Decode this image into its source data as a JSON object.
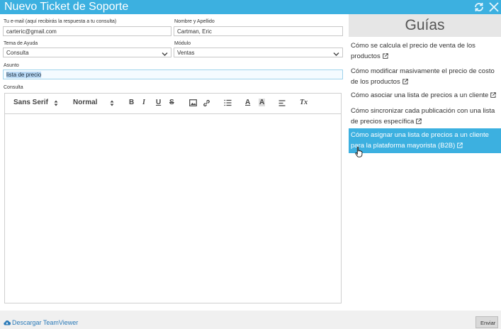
{
  "window": {
    "title": "Nuevo Ticket de Soporte"
  },
  "form": {
    "email": {
      "label": "Tu e-mail (aquí recibirás la respuesta a tu consulta)",
      "value": "carteric@gmail.com"
    },
    "nombre": {
      "label": "Nombre y Apellido",
      "value": "Cartman, Eric"
    },
    "tema": {
      "label": "Tema de Ayuda",
      "value": "Consulta"
    },
    "modulo": {
      "label": "Módulo",
      "value": "Ventas"
    },
    "asunto": {
      "label": "Asunto",
      "value": "lista de precio"
    },
    "consulta": {
      "label": "Consulta"
    }
  },
  "editor": {
    "font": "Sans Serif",
    "size": "Normal",
    "bold": "B",
    "italic": "I",
    "underline": "U",
    "strike": "S",
    "text_color": "A",
    "bg_color": "A",
    "clear_format": "Tx"
  },
  "sidebar": {
    "title": "Guías",
    "guides": [
      {
        "label": "Cómo se calcula el precio de venta de los productos"
      },
      {
        "label": "Cómo modificar masivamente el precio de costo de los productos"
      },
      {
        "label": "Cómo asociar una lista de precios a un cliente"
      },
      {
        "label": "Cómo sincronizar cada publicación con una lista de precios específica"
      },
      {
        "label": "Cómo asignar una lista de precios a un cliente para la plataforma mayorista (B2B)",
        "active": true
      }
    ]
  },
  "footer": {
    "teamviewer": "Descargar TeamViewer",
    "send": "Enviar"
  },
  "colors": {
    "accent": "#3cb0e0",
    "link": "#2a7ab8"
  }
}
